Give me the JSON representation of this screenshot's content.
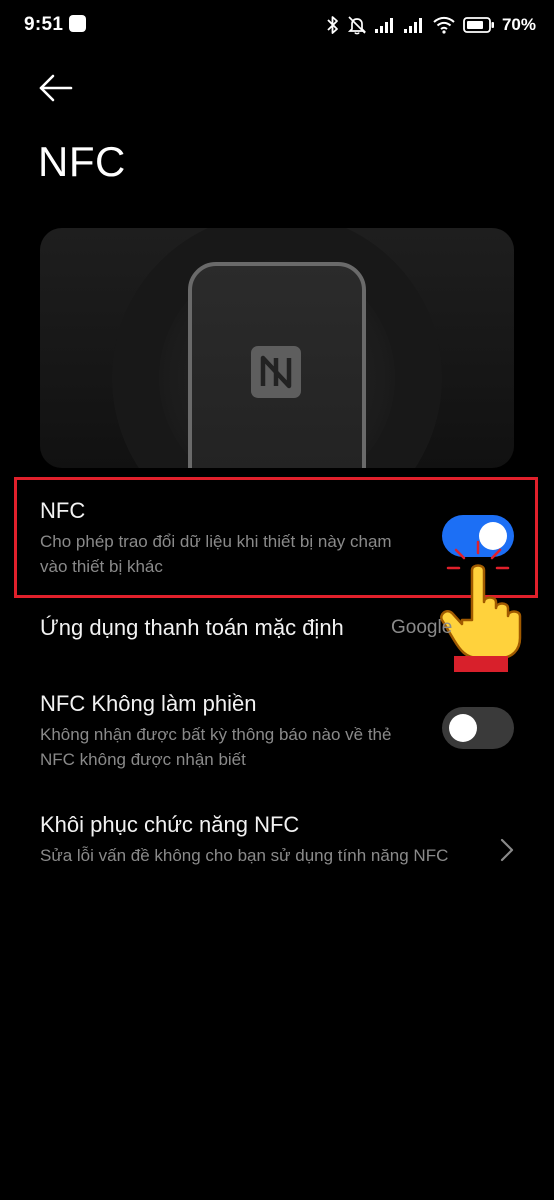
{
  "status_bar": {
    "time": "9:51",
    "battery_percent": "70%",
    "icons": [
      "bluetooth-icon",
      "bell-muted-icon",
      "signal-icon",
      "signal-icon",
      "wifi-icon",
      "battery-icon"
    ]
  },
  "header": {
    "back_icon": "arrow-left-icon",
    "title": "NFC"
  },
  "hero": {
    "illustration": "phone-with-nfc-logo"
  },
  "settings": {
    "nfc": {
      "title": "NFC",
      "description": "Cho phép trao đổi dữ liệu khi thiết bị này chạm vào thiết bị khác",
      "enabled": true
    },
    "default_payment": {
      "title": "Ứng dụng thanh toán mặc định",
      "value": "Google"
    },
    "nfc_dnd": {
      "title": "NFC Không làm phiền",
      "description": "Không nhận được bất kỳ thông báo nào về thẻ NFC không được nhận biết",
      "enabled": false
    },
    "restore": {
      "title": "Khôi phục chức năng NFC",
      "description": "Sửa lỗi vấn đề không cho bạn sử dụng tính năng NFC"
    }
  },
  "colors": {
    "background": "#000000",
    "toggle_on": "#1c6ff5",
    "toggle_off": "#3a3a3a",
    "highlight": "#e0202b",
    "secondary_text": "#8a8a8a"
  }
}
